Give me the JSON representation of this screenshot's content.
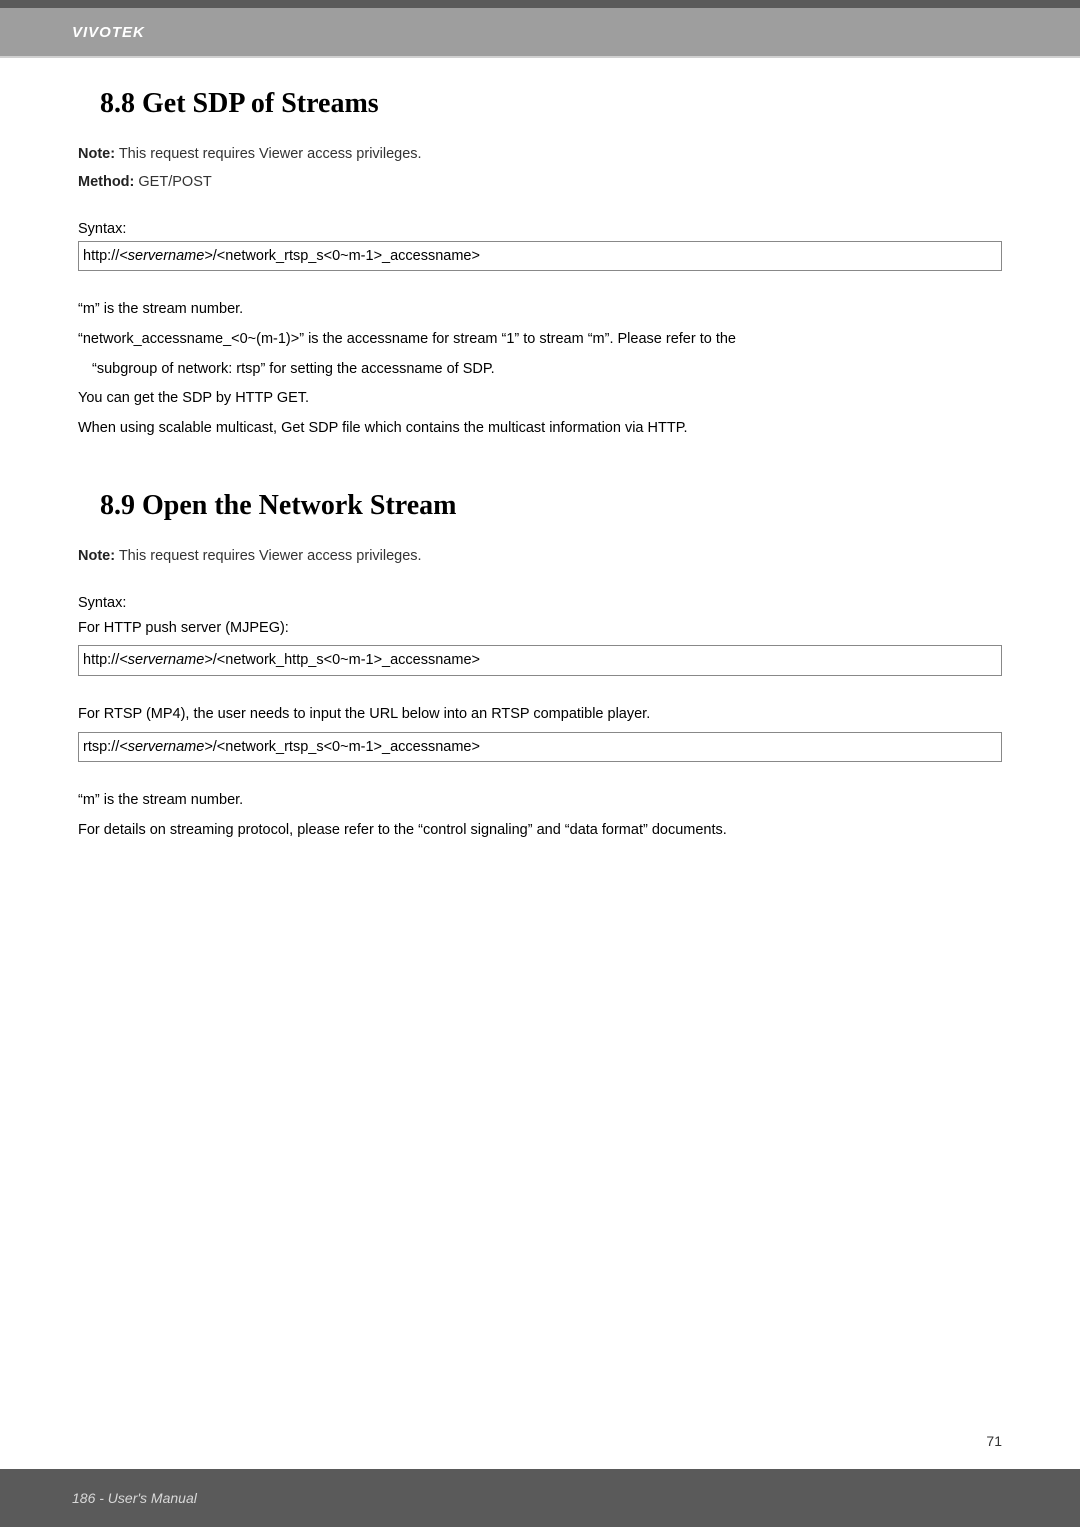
{
  "header": {
    "brand": "VIVOTEK"
  },
  "section88": {
    "heading": "8.8 Get SDP of Streams",
    "note_label": "Note:",
    "note_text": " This request requires Viewer access privileges.",
    "method_label": "Method:",
    "method_text": " GET/POST",
    "syntax_label": "Syntax:",
    "codebox_prefix": "http://",
    "codebox_ital": "<servername>",
    "codebox_suffix": "/<network_rtsp_s<0~m-1>_accessname>",
    "line1": "“m” is the stream number.",
    "line2": "“network_accessname_<0~(m-1)>” is the accessname for stream “1” to stream “m”. Please refer to the",
    "line3": "“subgroup of network: rtsp” for setting the accessname of SDP.",
    "line4": "You can get the SDP by HTTP GET.",
    "line5": "When using scalable multicast, Get SDP file which contains the multicast information via HTTP."
  },
  "section89": {
    "heading": "8.9 Open the Network Stream",
    "note_label": "Note:",
    "note_text": " This request requires Viewer access privileges.",
    "syntax_label": "Syntax:",
    "http_intro": "For HTTP push server (MJPEG):",
    "http_code_prefix": "http://",
    "http_code_ital": "<servername>",
    "http_code_suffix": "/<network_http_s<0~m-1>_accessname>",
    "rtsp_intro": "For RTSP (MP4), the user needs to input the URL below into an RTSP compatible player.",
    "rtsp_code_prefix": "rtsp://",
    "rtsp_code_ital": "<servername>",
    "rtsp_code_suffix": "/<network_rtsp_s<0~m-1>_accessname>",
    "stream_note": "“m” is the stream number.",
    "details": "For details on streaming protocol, please refer to the “control signaling” and “data format” documents."
  },
  "footer": {
    "page_left": "186 - User's Manual",
    "page_right": "71"
  }
}
